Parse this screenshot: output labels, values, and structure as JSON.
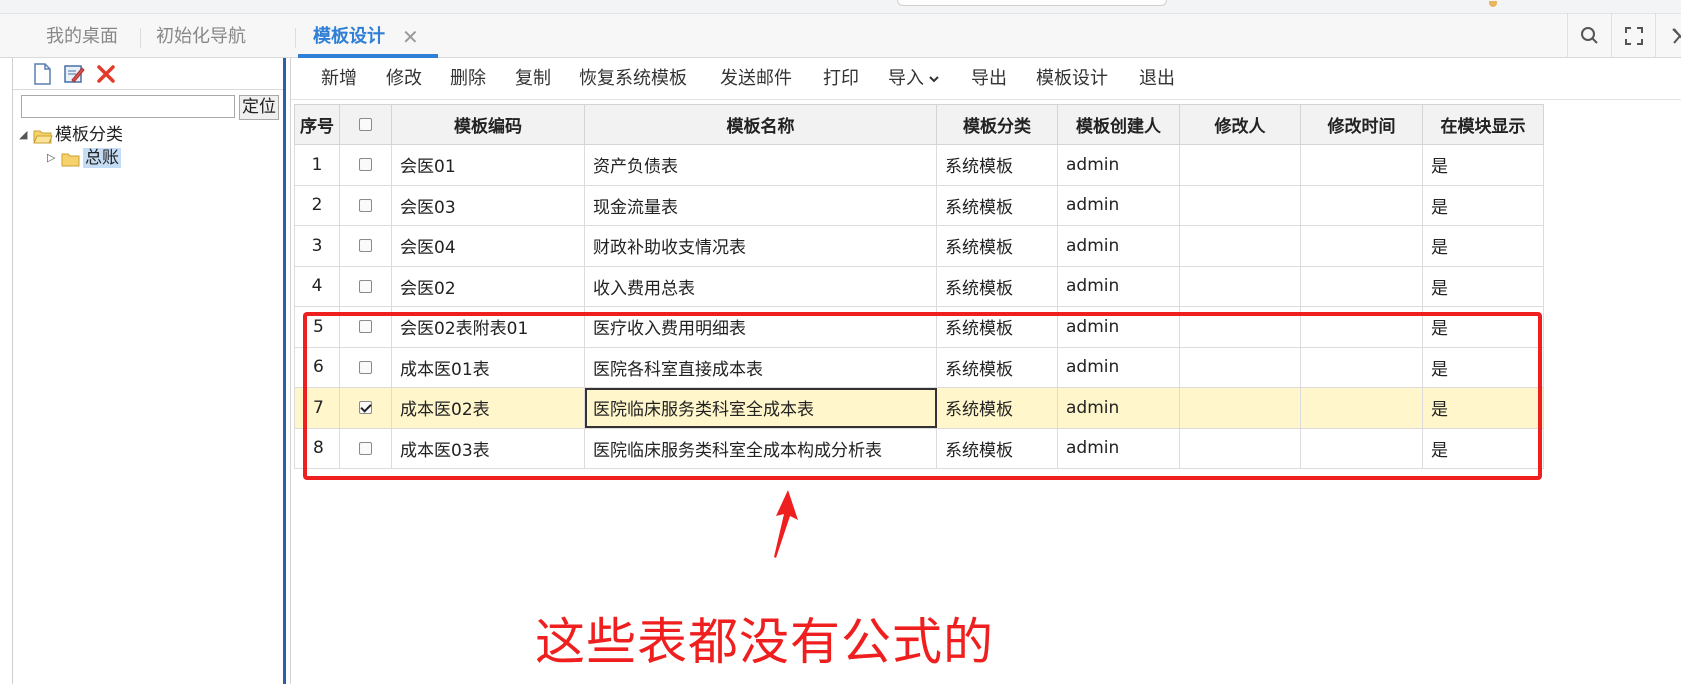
{
  "tabs": [
    {
      "label": "我的桌面"
    },
    {
      "label": "初始化导航"
    },
    {
      "label": "模板设计",
      "active": true
    }
  ],
  "tab_close_glyph": "✕",
  "right_tools": [
    "search-icon",
    "fullscreen-icon",
    "close-icon"
  ],
  "left_panel": {
    "toolbar_icons": [
      "new-doc-icon",
      "edit-icon",
      "delete-icon"
    ],
    "filter_placeholder": "",
    "locate_label": "定位",
    "tree": {
      "root": {
        "label": "模板分类",
        "expanded": true
      },
      "children": [
        {
          "label": "总账",
          "expanded": false,
          "selected": true
        }
      ]
    }
  },
  "main_toolbar": {
    "buttons": [
      "新增",
      "修改",
      "删除",
      "复制",
      "恢复系统模板",
      "发送邮件",
      "打印",
      "导入",
      "导出",
      "模板设计",
      "退出"
    ],
    "dropdown_index": 7
  },
  "grid": {
    "headers": [
      "序号",
      "",
      "模板编码",
      "模板名称",
      "模板分类",
      "模板创建人",
      "修改人",
      "修改时间",
      "在模块显示"
    ],
    "rows": [
      {
        "no": "1",
        "checked": false,
        "code": "会医01",
        "name": "资产负债表",
        "category": "系统模板",
        "creator": "admin",
        "modifier": "",
        "modified": "",
        "show": "是"
      },
      {
        "no": "2",
        "checked": false,
        "code": "会医03",
        "name": "现金流量表",
        "category": "系统模板",
        "creator": "admin",
        "modifier": "",
        "modified": "",
        "show": "是"
      },
      {
        "no": "3",
        "checked": false,
        "code": "会医04",
        "name": "财政补助收支情况表",
        "category": "系统模板",
        "creator": "admin",
        "modifier": "",
        "modified": "",
        "show": "是"
      },
      {
        "no": "4",
        "checked": false,
        "code": "会医02",
        "name": "收入费用总表",
        "category": "系统模板",
        "creator": "admin",
        "modifier": "",
        "modified": "",
        "show": "是"
      },
      {
        "no": "5",
        "checked": false,
        "code": "会医02表附表01",
        "name": "医疗收入费用明细表",
        "category": "系统模板",
        "creator": "admin",
        "modifier": "",
        "modified": "",
        "show": "是"
      },
      {
        "no": "6",
        "checked": false,
        "code": "成本医01表",
        "name": "医院各科室直接成本表",
        "category": "系统模板",
        "creator": "admin",
        "modifier": "",
        "modified": "",
        "show": "是"
      },
      {
        "no": "7",
        "checked": true,
        "selected": true,
        "code": "成本医02表",
        "name": "医院临床服务类科室全成本表",
        "category": "系统模板",
        "creator": "admin",
        "modifier": "",
        "modified": "",
        "show": "是"
      },
      {
        "no": "8",
        "checked": false,
        "code": "成本医03表",
        "name": "医院临床服务类科室全成本构成分析表",
        "category": "系统模板",
        "creator": "admin",
        "modifier": "",
        "modified": "",
        "show": "是"
      }
    ]
  },
  "annotation": {
    "text": "这些表都没有公式的",
    "color": "#f01f1f"
  },
  "colors": {
    "accent": "#2f7fd6",
    "selected_row": "#fff6cc",
    "annotation_red": "#f01f1f"
  }
}
